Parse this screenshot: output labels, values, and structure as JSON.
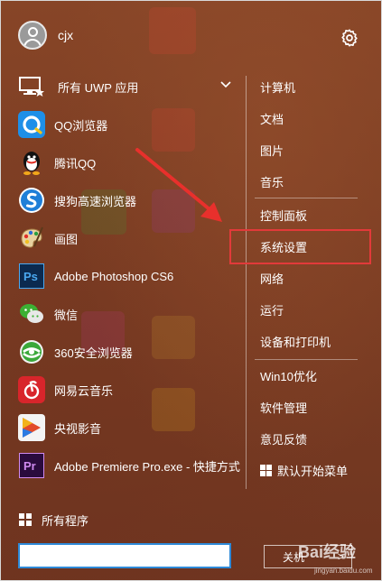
{
  "user": {
    "name": "cjx"
  },
  "left": {
    "uwp_label": "所有 UWP 应用",
    "apps": [
      {
        "label": "QQ浏览器",
        "icon": "qq-browser-icon",
        "color": "#1e8fe8"
      },
      {
        "label": "腾讯QQ",
        "icon": "qq-penguin-icon",
        "color": "#111111"
      },
      {
        "label": "搜狗高速浏览器",
        "icon": "sogou-browser-icon",
        "color": "#1f7fd8"
      },
      {
        "label": "画图",
        "icon": "paint-palette-icon",
        "color": "#c8a060"
      },
      {
        "label": "Adobe Photoshop CS6",
        "icon": "photoshop-icon",
        "color": "#0b2a4f"
      },
      {
        "label": "微信",
        "icon": "wechat-icon",
        "color": "#3cb034"
      },
      {
        "label": "360安全浏览器",
        "icon": "360-browser-icon",
        "color": "#3aa83a"
      },
      {
        "label": "网易云音乐",
        "icon": "netease-music-icon",
        "color": "#d8252b"
      },
      {
        "label": "央视影音",
        "icon": "cctv-video-icon",
        "color": "#e24a2a"
      },
      {
        "label": "Adobe Premiere Pro.exe - 快捷方式",
        "icon": "premiere-icon",
        "color": "#2a0b3d"
      }
    ],
    "all_programs": "所有程序"
  },
  "search": {
    "value": ""
  },
  "right": {
    "group1": [
      "计算机",
      "文档",
      "图片",
      "音乐"
    ],
    "group2": [
      "控制面板",
      "系统设置",
      "网络",
      "运行",
      "设备和打印机"
    ],
    "group3": [
      "Win10优化",
      "软件管理",
      "意见反馈",
      "默认开始菜单"
    ]
  },
  "power": {
    "label": "关机"
  },
  "watermark": {
    "text": "Bai经验",
    "sub": "jingyan.baidu.com"
  },
  "colors": {
    "highlight": "#e23a3a",
    "search_border": "#2e8ad8"
  }
}
